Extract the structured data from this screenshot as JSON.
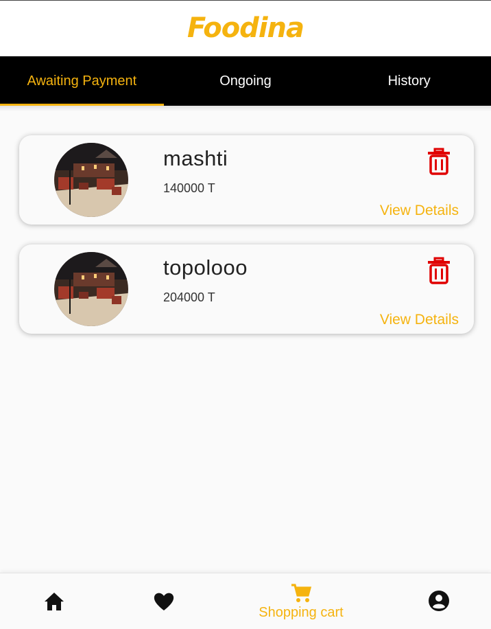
{
  "app": {
    "title": "Foodina"
  },
  "tabs": [
    {
      "label": "Awaiting Payment",
      "active": true
    },
    {
      "label": "Ongoing",
      "active": false
    },
    {
      "label": "History",
      "active": false
    }
  ],
  "orders": [
    {
      "name": "mashti",
      "price": "140000 T",
      "details_label": "View Details",
      "image": "restaurant-interior-photo"
    },
    {
      "name": "topolooo",
      "price": "204000 T",
      "details_label": "View Details",
      "image": "restaurant-interior-photo"
    }
  ],
  "bottom_nav": {
    "items": [
      {
        "icon": "home-icon",
        "label": ""
      },
      {
        "icon": "heart-icon",
        "label": ""
      },
      {
        "icon": "cart-icon",
        "label": "Shopping cart",
        "active": true
      },
      {
        "icon": "account-icon",
        "label": ""
      }
    ]
  },
  "colors": {
    "accent": "#f5b30f",
    "tab_bar": "#000000",
    "delete": "#e00000",
    "background": "#fafafa"
  }
}
